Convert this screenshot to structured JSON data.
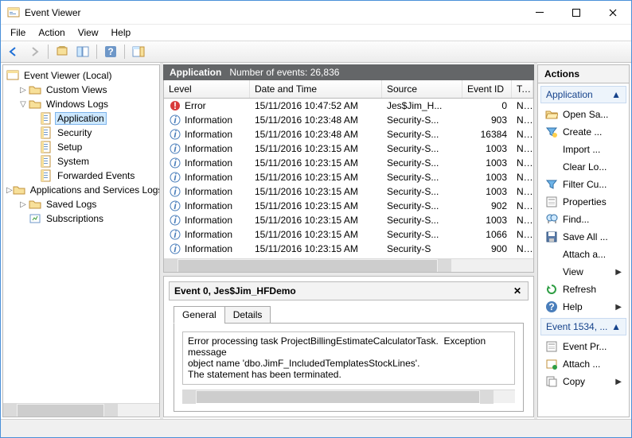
{
  "window": {
    "title": "Event Viewer"
  },
  "menubar": [
    "File",
    "Action",
    "View",
    "Help"
  ],
  "tree": {
    "root": "Event Viewer (Local)",
    "items": [
      {
        "label": "Custom Views",
        "expander": "▷",
        "depth": 1,
        "icon": "folder-view"
      },
      {
        "label": "Windows Logs",
        "expander": "▽",
        "depth": 1,
        "icon": "folder"
      },
      {
        "label": "Application",
        "expander": "",
        "depth": 2,
        "icon": "log",
        "selected": true
      },
      {
        "label": "Security",
        "expander": "",
        "depth": 2,
        "icon": "log"
      },
      {
        "label": "Setup",
        "expander": "",
        "depth": 2,
        "icon": "log"
      },
      {
        "label": "System",
        "expander": "",
        "depth": 2,
        "icon": "log"
      },
      {
        "label": "Forwarded Events",
        "expander": "",
        "depth": 2,
        "icon": "log"
      },
      {
        "label": "Applications and Services Logs",
        "expander": "▷",
        "depth": 1,
        "icon": "folder"
      },
      {
        "label": "Saved Logs",
        "expander": "▷",
        "depth": 1,
        "icon": "folder"
      },
      {
        "label": "Subscriptions",
        "expander": "",
        "depth": 1,
        "icon": "subscription"
      }
    ]
  },
  "grid": {
    "title": "Application",
    "subtitle": "Number of events: 26,836",
    "columns": {
      "level": "Level",
      "date": "Date and Time",
      "source": "Source",
      "eventid": "Event ID",
      "task": "Task C"
    },
    "rows": [
      {
        "level": "Error",
        "icon": "error",
        "date": "15/11/2016 10:47:52 AM",
        "source": "Jes$Jim_H...",
        "eventid": "0",
        "task": "None"
      },
      {
        "level": "Information",
        "icon": "info",
        "date": "15/11/2016 10:23:48 AM",
        "source": "Security-S...",
        "eventid": "903",
        "task": "None"
      },
      {
        "level": "Information",
        "icon": "info",
        "date": "15/11/2016 10:23:48 AM",
        "source": "Security-S...",
        "eventid": "16384",
        "task": "None"
      },
      {
        "level": "Information",
        "icon": "info",
        "date": "15/11/2016 10:23:15 AM",
        "source": "Security-S...",
        "eventid": "1003",
        "task": "None"
      },
      {
        "level": "Information",
        "icon": "info",
        "date": "15/11/2016 10:23:15 AM",
        "source": "Security-S...",
        "eventid": "1003",
        "task": "None"
      },
      {
        "level": "Information",
        "icon": "info",
        "date": "15/11/2016 10:23:15 AM",
        "source": "Security-S...",
        "eventid": "1003",
        "task": "None"
      },
      {
        "level": "Information",
        "icon": "info",
        "date": "15/11/2016 10:23:15 AM",
        "source": "Security-S...",
        "eventid": "1003",
        "task": "None"
      },
      {
        "level": "Information",
        "icon": "info",
        "date": "15/11/2016 10:23:15 AM",
        "source": "Security-S...",
        "eventid": "902",
        "task": "None"
      },
      {
        "level": "Information",
        "icon": "info",
        "date": "15/11/2016 10:23:15 AM",
        "source": "Security-S...",
        "eventid": "1003",
        "task": "None"
      },
      {
        "level": "Information",
        "icon": "info",
        "date": "15/11/2016 10:23:15 AM",
        "source": "Security-S...",
        "eventid": "1066",
        "task": "None"
      },
      {
        "level": "Information",
        "icon": "info",
        "date": "15/11/2016 10:23:15 AM",
        "source": "Security-S",
        "eventid": "900",
        "task": "Non"
      }
    ]
  },
  "detail": {
    "title": "Event 0, Jes$Jim_HFDemo",
    "tabs": [
      "General",
      "Details"
    ],
    "message": "Error processing task ProjectBillingEstimateCalculatorTask.  Exception message\nobject name 'dbo.JimF_IncludedTemplatesStockLines'.\nThe statement has been terminated."
  },
  "actions": {
    "header": "Actions",
    "groups": [
      {
        "title": "Application",
        "items": [
          {
            "label": "Open Sa...",
            "icon": "folder-open"
          },
          {
            "label": "Create ...",
            "icon": "funnel-new"
          },
          {
            "label": "Import ...",
            "icon": "blank"
          },
          {
            "label": "Clear Lo...",
            "icon": "blank"
          },
          {
            "label": "Filter Cu...",
            "icon": "funnel"
          },
          {
            "label": "Properties",
            "icon": "properties"
          },
          {
            "label": "Find...",
            "icon": "find"
          },
          {
            "label": "Save All ...",
            "icon": "save"
          },
          {
            "label": "Attach a...",
            "icon": "blank"
          },
          {
            "label": "View",
            "icon": "blank",
            "submenu": true
          },
          {
            "label": "Refresh",
            "icon": "refresh"
          },
          {
            "label": "Help",
            "icon": "help",
            "submenu": true
          }
        ]
      },
      {
        "title": "Event 1534, ...",
        "items": [
          {
            "label": "Event Pr...",
            "icon": "properties"
          },
          {
            "label": "Attach ...",
            "icon": "attach"
          },
          {
            "label": "Copy",
            "icon": "copy",
            "submenu": true
          }
        ]
      }
    ]
  }
}
